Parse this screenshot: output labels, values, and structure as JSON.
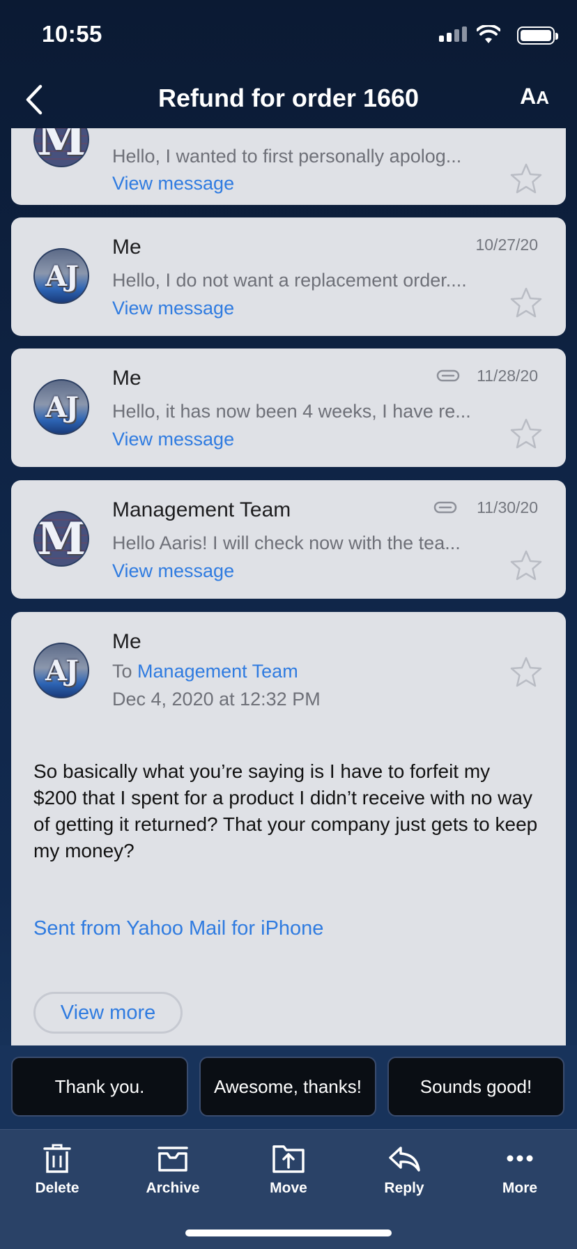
{
  "status": {
    "time": "10:55"
  },
  "header": {
    "title": "Refund for order 1660",
    "font_size_label_big": "A",
    "font_size_label_small": "A"
  },
  "messages": [
    {
      "avatar": "M",
      "sender": "",
      "snippet": "Hello, I wanted to first personally apolog...",
      "link": "View message",
      "date": ""
    },
    {
      "avatar": "AJ",
      "sender": "Me",
      "snippet": "Hello, I do not want a replacement order....",
      "link": "View message",
      "date": "10/27/20"
    },
    {
      "avatar": "AJ",
      "sender": "Me",
      "snippet": "Hello, it has now been 4 weeks, I have re...",
      "link": "View message",
      "date": "11/28/20",
      "attachment": true
    },
    {
      "avatar": "M",
      "sender": "Management Team",
      "snippet": "Hello Aaris! I will check now with the tea...",
      "link": "View message",
      "date": "11/30/20",
      "attachment": true
    }
  ],
  "open_message": {
    "avatar": "AJ",
    "sender": "Me",
    "to_prefix": "To",
    "to_name": "Management Team",
    "date": "Dec 4, 2020 at 12:32 PM",
    "body": "So basically what you’re saying is I have to forfeit my $200 that I spent for a product I didn’t receive with no way of getting it returned? That your company just gets to keep my money?",
    "signature": "Sent from Yahoo Mail for iPhone",
    "view_more": "View more"
  },
  "quick_replies": [
    "Thank you.",
    "Awesome, thanks!",
    "Sounds good!"
  ],
  "toolbar": {
    "delete": "Delete",
    "archive": "Archive",
    "move": "Move",
    "reply": "Reply",
    "more": "More"
  },
  "icons": {
    "back": "chevron-left-icon",
    "font_size": "text-size-icon",
    "star": "star-icon",
    "attachment": "paperclip-icon"
  }
}
